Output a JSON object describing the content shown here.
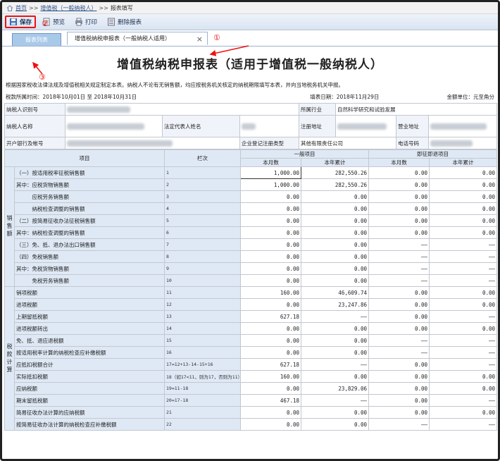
{
  "breadcrumb": {
    "home": "首页",
    "sep": ">>",
    "item1": "增值税（一般纳税人）",
    "item2": "报表填写"
  },
  "toolbar": {
    "save": "保存",
    "preview": "预览",
    "print": "打印",
    "delete": "删除报表"
  },
  "tabs": {
    "list": "报表列表",
    "form": "增值税纳税申报表（一般纳税人适用）",
    "close": "×"
  },
  "annotations": {
    "a1": "①",
    "a2": "②",
    "a3": "③"
  },
  "form": {
    "title": "增值税纳税申报表（适用于增值税一般纳税人）",
    "notice": "根据国家税收法律法规及增值税相关规定制定本表。纳税人不论有无销售额，均应按税务机关核定的纳税期限填写本表，并向当地税务机关申报。",
    "period": "税款所属时间：2018年10月01日 至 2018年10月31日",
    "fill_date": "填表日期：2018年11月29日",
    "unit": "金额单位：元至角分",
    "info": {
      "taxpayer_id_label": "纳税人识别号",
      "industry_label": "所属行业",
      "industry_value": "自然科学研究和试验发展",
      "name_label": "纳税人名称",
      "legal_rep_label": "法定代表人姓名",
      "reg_addr_label": "注册地址",
      "biz_addr_label": "营业地址",
      "bank_label": "开户银行及帐号",
      "reg_type_label": "企业登记注册类型",
      "reg_type_value": "其他有限责任公司",
      "phone_label": "电话号码"
    },
    "header": {
      "item": "项目",
      "col": "栏次",
      "general": "一般项目",
      "refund": "即征即退项目",
      "month": "本月数",
      "year": "本年累计"
    },
    "sections": {
      "sales": "销售额",
      "tax": "税款计算"
    },
    "rows": [
      {
        "label": "（一）按适用税率征税销售额",
        "line": "1",
        "v1": "1,000.00",
        "v2": "282,550.26",
        "v3": "0.00",
        "v4": "0.00"
      },
      {
        "label": "其中：应税货物销售额",
        "line": "2",
        "v1": "1,000.00",
        "v2": "282,550.26",
        "v3": "0.00",
        "v4": "0.00"
      },
      {
        "label": "　　　应税劳务销售额",
        "line": "3",
        "v1": "0.00",
        "v2": "0.00",
        "v3": "0.00",
        "v4": "0.00"
      },
      {
        "label": "　　　纳税检查调整的销售额",
        "line": "4",
        "v1": "0.00",
        "v2": "0.00",
        "v3": "0.00",
        "v4": "0.00"
      },
      {
        "label": "（二）按简易征收办法征税销售额",
        "line": "5",
        "v1": "0.00",
        "v2": "0.00",
        "v3": "0.00",
        "v4": "0.00"
      },
      {
        "label": "其中：纳税检查调整的销售额",
        "line": "6",
        "v1": "0.00",
        "v2": "0.00",
        "v3": "0.00",
        "v4": "0.00"
      },
      {
        "label": "（三）免、抵、退办法出口销售额",
        "line": "7",
        "v1": "0.00",
        "v2": "0.00",
        "v3": "——",
        "v4": "——"
      },
      {
        "label": "（四）免税销售额",
        "line": "8",
        "v1": "0.00",
        "v2": "0.00",
        "v3": "——",
        "v4": "——"
      },
      {
        "label": "其中：免税货物销售额",
        "line": "9",
        "v1": "0.00",
        "v2": "0.00",
        "v3": "——",
        "v4": "——"
      },
      {
        "label": "　　　免税劳务销售额",
        "line": "10",
        "v1": "0.00",
        "v2": "0.00",
        "v3": "——",
        "v4": "——"
      },
      {
        "label": "销项税额",
        "line": "11",
        "v1": "160.00",
        "v2": "46,609.74",
        "v3": "0.00",
        "v4": "0.00"
      },
      {
        "label": "进项税额",
        "line": "12",
        "v1": "0.00",
        "v2": "23,247.86",
        "v3": "0.00",
        "v4": "0.00"
      },
      {
        "label": "上期留抵税额",
        "line": "13",
        "v1": "627.18",
        "v2": "——",
        "v3": "0.00",
        "v4": "——"
      },
      {
        "label": "进项税额转出",
        "line": "14",
        "v1": "0.00",
        "v2": "0.00",
        "v3": "0.00",
        "v4": "0.00"
      },
      {
        "label": "免、抵、退应退税额",
        "line": "15",
        "v1": "0.00",
        "v2": "0.00",
        "v3": "——",
        "v4": "——"
      },
      {
        "label": "按适用税率计算的纳税检查应补缴税额",
        "line": "16",
        "v1": "0.00",
        "v2": "0.00",
        "v3": "——",
        "v4": "——"
      },
      {
        "label": "应抵扣税额合计",
        "line": "17=12+13-14-15+16",
        "v1": "627.18",
        "v2": "——",
        "v3": "0.00",
        "v4": "——"
      },
      {
        "label": "实际抵扣税额",
        "line": "18（如17<11，则为17，否则为11）",
        "v1": "160.00",
        "v2": "0.00",
        "v3": "0.00",
        "v4": "0.00"
      },
      {
        "label": "应纳税额",
        "line": "19=11-18",
        "v1": "0.00",
        "v2": "23,829.06",
        "v3": "0.00",
        "v4": "0.00"
      },
      {
        "label": "期末留抵税额",
        "line": "20=17-18",
        "v1": "467.18",
        "v2": "——",
        "v3": "0.00",
        "v4": "——"
      },
      {
        "label": "简易征收办法计算的应纳税额",
        "line": "21",
        "v1": "0.00",
        "v2": "0.00",
        "v3": "0.00",
        "v4": "0.00"
      },
      {
        "label": "按简易征收办法计算的纳税检查应补缴税额",
        "line": "22",
        "v1": "0.00",
        "v2": "0.00",
        "v3": "——",
        "v4": "——"
      }
    ]
  }
}
